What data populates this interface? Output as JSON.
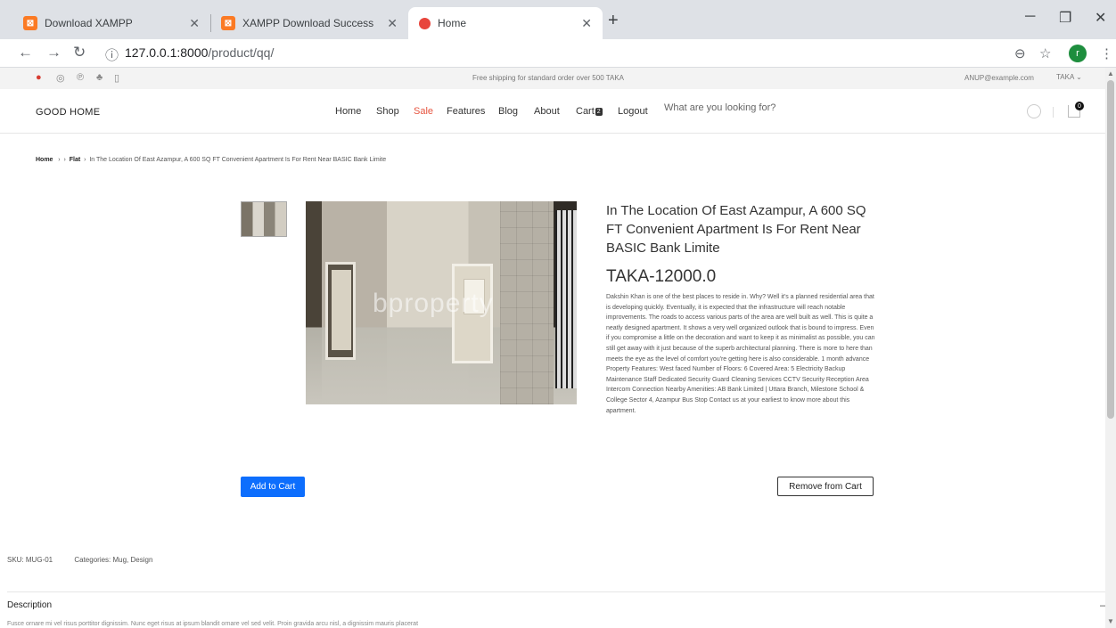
{
  "browser": {
    "tabs": [
      {
        "title": "Download XAMPP",
        "favicon": "xampp-icon",
        "active": false
      },
      {
        "title": "XAMPP Download Success",
        "favicon": "xampp-icon",
        "active": false
      },
      {
        "title": "Home",
        "favicon": "red-dot-icon",
        "active": true
      }
    ],
    "url_host": "127.0.0.1:8000",
    "url_path": "/product/qq/",
    "profile_initial": "r",
    "favicon_color": "#fb7a24"
  },
  "topbar": {
    "shipping": "Free shipping for standard order over 500 TAKA",
    "email": "ANUP@example.com",
    "currency": "TAKA"
  },
  "header": {
    "logo": "GOOD HOME",
    "menu": {
      "home": "Home",
      "shop": "Shop",
      "sale": "Sale",
      "features": "Features",
      "blog": "Blog",
      "about": "About",
      "cart": "Cart",
      "cart_count": "2",
      "logout": "Logout"
    },
    "search_placeholder": "What are you looking for?",
    "bag_count": "0"
  },
  "breadcrumb": {
    "home": "Home",
    "category": "Flat",
    "current": "In The Location Of East Azampur, A 600 SQ FT Convenient Apartment Is For Rent Near BASIC Bank Limite"
  },
  "product": {
    "title": "In The Location Of East Azampur, A 600 SQ FT Convenient Apartment Is For Rent Near BASIC Bank Limite",
    "price": "TAKA-12000.0",
    "description": "Dakshin Khan is one of the best places to reside in. Why? Well it's a planned residential area that is developing quickly. Eventually, it is expected that the infrastructure will reach notable improvements. The roads to access various parts of the area are well built as well. This is quite a neatly designed apartment. It shows a very well organized outlook that is bound to impress. Even if you compromise a little on the decoration and want to keep it as minimalist as possible, you can still get away with it just because of the superb architectural planning. There is more to here than meets the eye as the level of comfort you're getting here is also considerable. 1 month advance Property Features: West faced Number of Floors: 6 Covered Area: 5 Electricity Backup Maintenance Staff Dedicated Security Guard Cleaning Services CCTV Security Reception Area Intercom Connection Nearby Amenities: AB Bank Limited | Uttara Branch, Milestone School & College Sector 4, Azampur Bus Stop Contact us at your earliest to know more about this apartment.",
    "image_watermark": "bproperty",
    "add_to_cart": "Add to Cart",
    "remove_from_cart": "Remove from Cart"
  },
  "meta": {
    "sku": "SKU: MUG-01",
    "categories": "Categories: Mug, Design"
  },
  "description_section": {
    "heading": "Description",
    "text": "Fusce ornare mi vel risus porttitor dignissim. Nunc eget risus at ipsum blandit ornare vel sed velit. Proin gravida arcu nisl, a dignissim mauris placerat"
  },
  "colors": {
    "accent_button": "#0d6efd",
    "sale": "#e65540"
  }
}
